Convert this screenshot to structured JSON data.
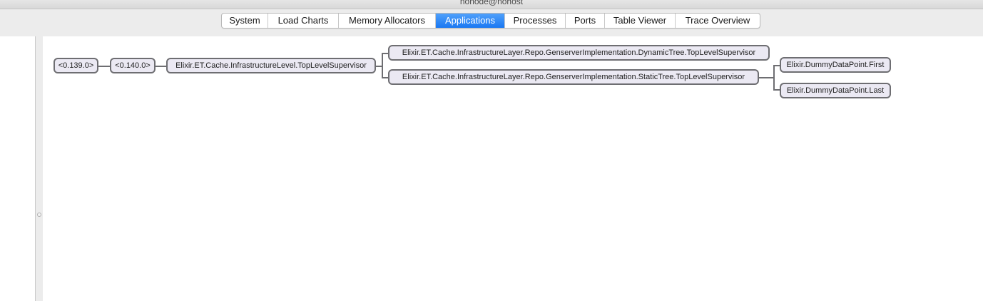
{
  "window": {
    "title": "nonode@nohost"
  },
  "tabs": [
    {
      "label": "System"
    },
    {
      "label": "Load Charts"
    },
    {
      "label": "Memory Allocators"
    },
    {
      "label": "Applications",
      "active": true
    },
    {
      "label": "Processes"
    },
    {
      "label": "Ports"
    },
    {
      "label": "Table Viewer"
    },
    {
      "label": "Trace Overview"
    }
  ],
  "tree": {
    "nodes": [
      {
        "label": "<0.139.0>"
      },
      {
        "label": "<0.140.0>"
      },
      {
        "label": "Elixir.ET.Cache.InfrastructureLevel.TopLevelSupervisor"
      },
      {
        "label": "Elixir.ET.Cache.InfrastructureLayer.Repo.GenserverImplementation.DynamicTree.TopLevelSupervisor"
      },
      {
        "label": "Elixir.ET.Cache.InfrastructureLayer.Repo.GenserverImplementation.StaticTree.TopLevelSupervisor"
      },
      {
        "label": "Elixir.DummyDataPoint.First"
      },
      {
        "label": "Elixir.DummyDataPoint.Last"
      }
    ]
  },
  "colors": {
    "accent": "#1a78f2",
    "node_fill": "#ebe9f3",
    "node_border": "#6e6e72"
  }
}
